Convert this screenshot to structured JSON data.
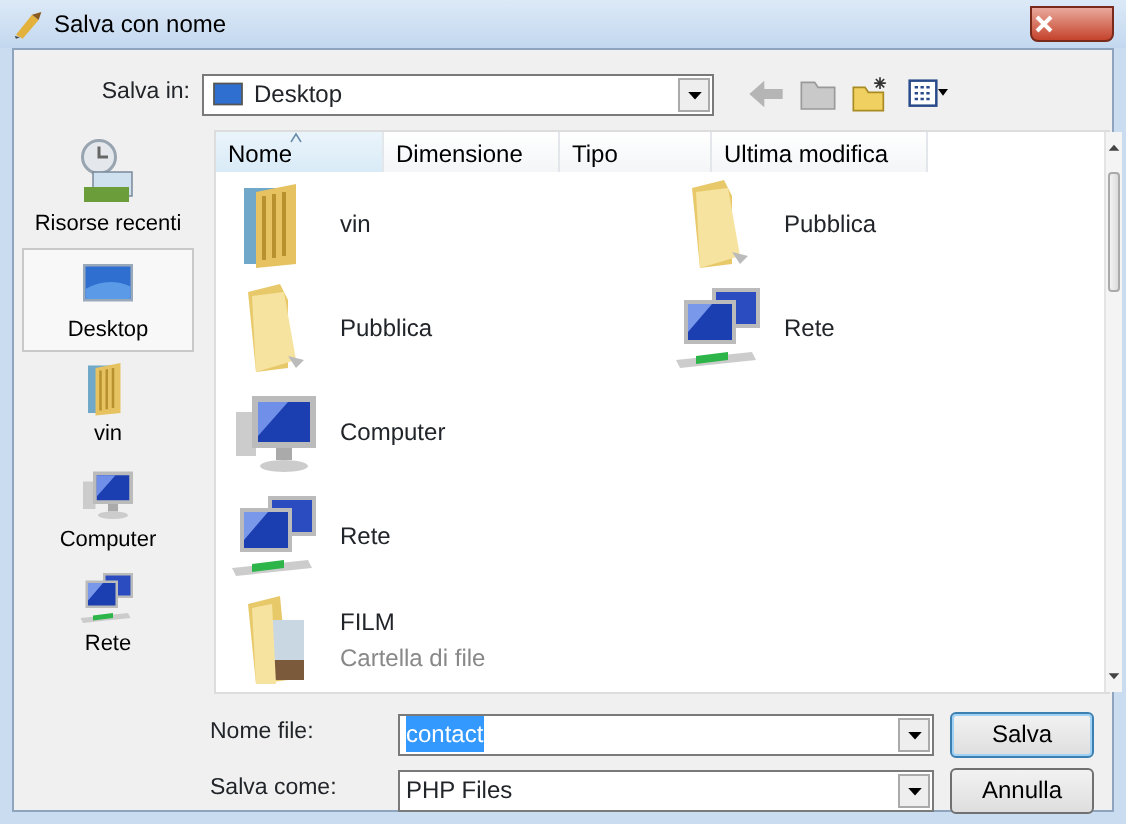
{
  "window": {
    "title": "Salva con nome"
  },
  "location": {
    "label": "Salva in:",
    "value": "Desktop"
  },
  "sidebar": {
    "items": [
      {
        "label": "Risorse recenti",
        "kind": "recent",
        "selected": false
      },
      {
        "label": "Desktop",
        "kind": "desktop",
        "selected": true
      },
      {
        "label": "vin",
        "kind": "userfolder",
        "selected": false
      },
      {
        "label": "Computer",
        "kind": "computer",
        "selected": false
      },
      {
        "label": "Rete",
        "kind": "network",
        "selected": false
      }
    ]
  },
  "columns": [
    {
      "label": "Nome",
      "sorted": true
    },
    {
      "label": "Dimensione",
      "sorted": false
    },
    {
      "label": "Tipo",
      "sorted": false
    },
    {
      "label": "Ultima modifica",
      "sorted": false
    }
  ],
  "files": [
    {
      "name": "vin",
      "kind": "userfolder"
    },
    {
      "name": "Pubblica",
      "kind": "folder"
    },
    {
      "name": "Computer",
      "kind": "computer"
    },
    {
      "name": "Rete",
      "kind": "network"
    },
    {
      "name": "FILM",
      "kind": "filmfolder",
      "subtitle": "Cartella di file"
    },
    {
      "name": "Pubblica",
      "kind": "folder"
    },
    {
      "name": "Rete",
      "kind": "network"
    }
  ],
  "filename": {
    "label": "Nome file:",
    "value": "contact",
    "text_selected": true
  },
  "filetype": {
    "label": "Salva come:",
    "value": "PHP Files"
  },
  "buttons": [
    {
      "label": "Salva",
      "kind": "primary"
    },
    {
      "label": "Annulla",
      "kind": "cancel"
    }
  ]
}
